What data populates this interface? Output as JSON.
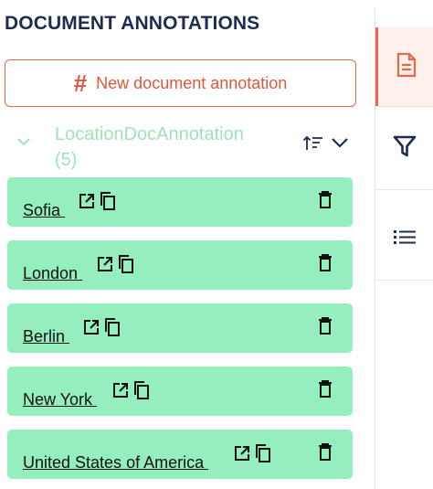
{
  "panel": {
    "title": "DOCUMENT ANNOTATIONS",
    "new_button_label": "New document annotation"
  },
  "group": {
    "name": "LocationDocAnnotation",
    "count": "(5)"
  },
  "annotations": [
    {
      "label": "Sofia "
    },
    {
      "label": "London "
    },
    {
      "label": "Berlin "
    },
    {
      "label": "New York "
    },
    {
      "label": "United States of America "
    }
  ],
  "colors": {
    "accent": "#e8674a",
    "item_bg": "#95eebd",
    "title": "#1d2d50",
    "group_text": "#9ee3b9"
  },
  "icons": {
    "new_button": "hash-icon",
    "group_toggle": "chevron-down-icon",
    "sort": "sort-icon",
    "item_open": "open-external-icon",
    "item_copy": "copy-icon",
    "item_delete": "trash-icon",
    "side_tabs": [
      "document-icon",
      "filter-icon",
      "list-icon"
    ]
  }
}
